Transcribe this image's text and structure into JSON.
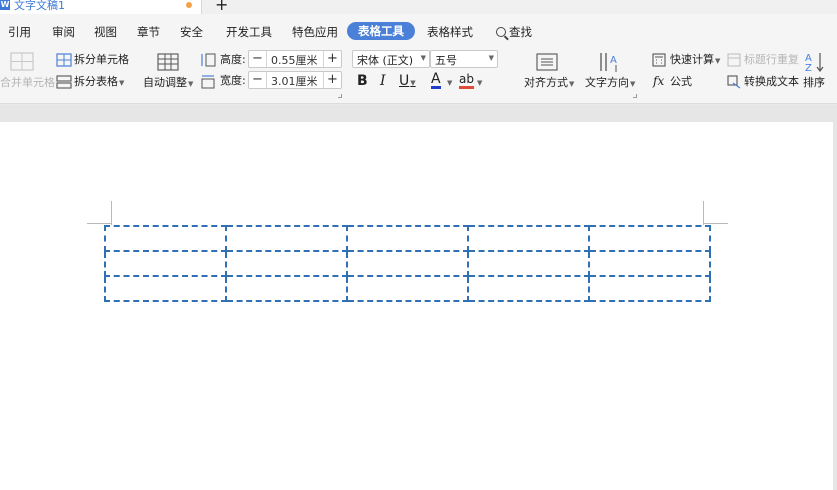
{
  "tab": {
    "doc_name": "文字文稿1",
    "icon_letter": "W",
    "new_tab": "+"
  },
  "menu": {
    "items": [
      "引用",
      "审阅",
      "视图",
      "章节",
      "安全",
      "开发工具",
      "特色应用",
      "表格工具",
      "表格样式"
    ],
    "active": "表格工具",
    "search": "查找"
  },
  "ribbon": {
    "merge_cells": "合并单元格",
    "split_cells": "拆分单元格",
    "split_table": "拆分表格",
    "auto_fit": "自动调整",
    "height_label": "高度:",
    "height_value": "0.55厘米",
    "width_label": "宽度:",
    "width_value": "3.01厘米",
    "minus": "−",
    "plus": "+",
    "font_name": "宋体 (正文)",
    "font_size": "五号",
    "bold": "B",
    "italic": "I",
    "underline": "U",
    "font_color": "A",
    "highlight": "ab",
    "align": "对齐方式",
    "text_direction": "文字方向",
    "quick_calc": "快速计算",
    "formula_fx": "fx",
    "formula": "公式",
    "repeat_header": "标题行重复",
    "convert_text": "转换成文本",
    "sort": "排序"
  },
  "colors": {
    "accent": "#4b80d8",
    "table_border": "#2f6fb4",
    "font_color_bar": "#1f3fc8",
    "highlight_bar": "#e04a3a"
  },
  "table": {
    "rows": 3,
    "cols": 5
  }
}
